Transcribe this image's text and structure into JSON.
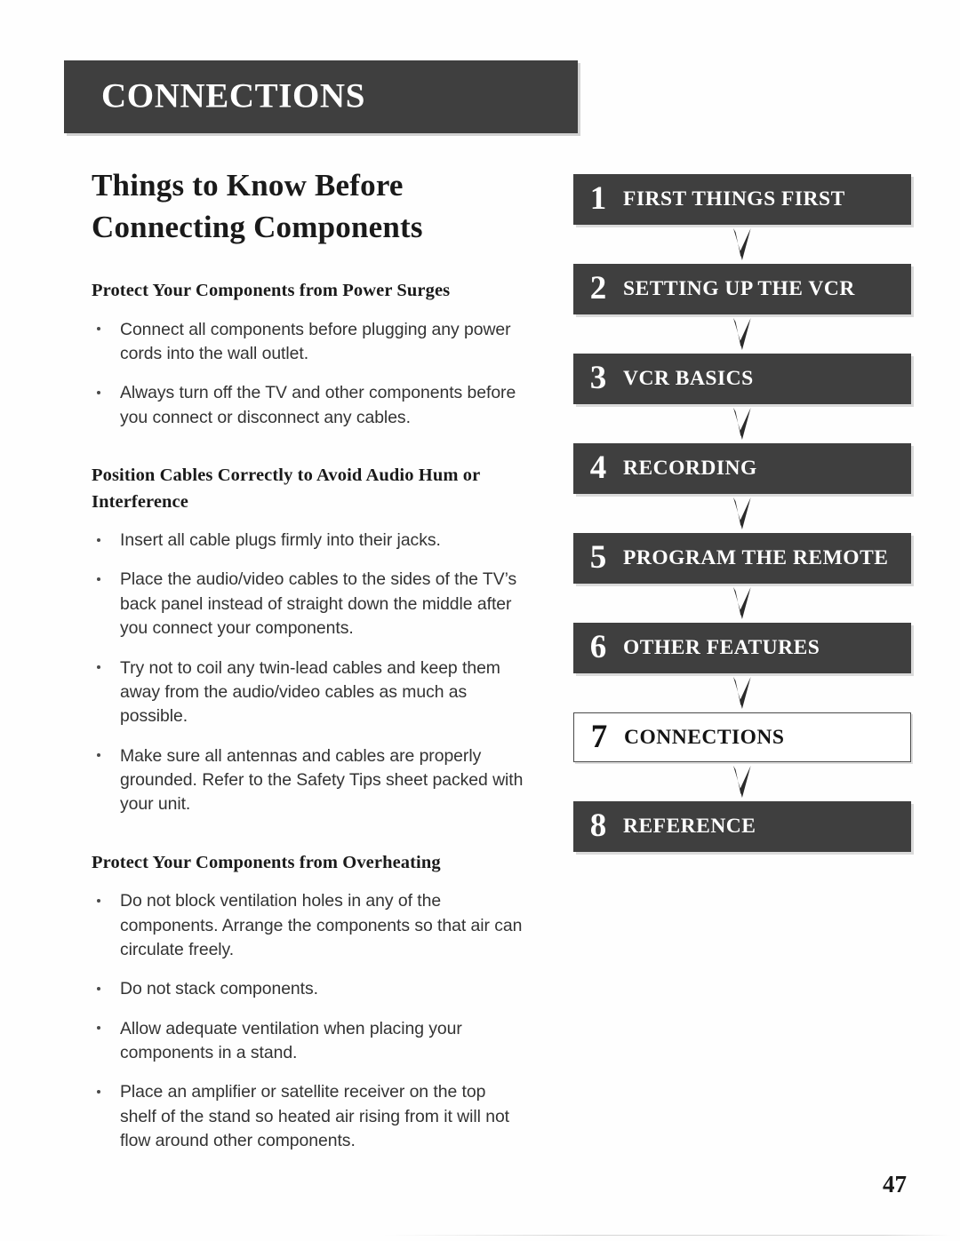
{
  "document": {
    "section_banner": "CONNECTIONS",
    "page_number": "47",
    "title": "Things to Know Before Connecting Components"
  },
  "content": {
    "subsections": [
      {
        "heading": "Protect Your Components from Power Surges",
        "bullets": [
          "Connect all components before plugging any power cords into the wall outlet.",
          "Always turn off the TV and other components before you connect or disconnect any cables."
        ]
      },
      {
        "heading": "Position Cables Correctly to Avoid Audio Hum or Interference",
        "bullets": [
          "Insert all cable plugs firmly into their jacks.",
          "Place the audio/video cables to the sides of the TV’s back panel instead of straight down the middle after you connect your components.",
          "Try not to coil any twin-lead cables and keep them away from the audio/video cables as much as possible.",
          "Make sure all antennas and cables are properly grounded. Refer to the Safety Tips sheet packed with your unit."
        ]
      },
      {
        "heading": "Protect Your Components from Overheating",
        "bullets": [
          "Do not block ventilation holes in any of the components.  Arrange the components so that air can circulate freely.",
          "Do not stack components.",
          "Allow adequate ventilation when placing your components in a stand.",
          "Place an amplifier or satellite receiver on the top shelf of the stand so heated air rising from it will not flow around other components."
        ]
      }
    ]
  },
  "nav_chain": {
    "arrow_icon": "chevron-down-arrow-icon",
    "items": [
      {
        "number": "1",
        "label": "FIRST THINGS FIRST",
        "current": false
      },
      {
        "number": "2",
        "label": "SETTING UP THE VCR",
        "current": false
      },
      {
        "number": "3",
        "label": "VCR BASICS",
        "current": false
      },
      {
        "number": "4",
        "label": "RECORDING",
        "current": false
      },
      {
        "number": "5",
        "label": "PROGRAM THE REMOTE",
        "current": false
      },
      {
        "number": "6",
        "label": "OTHER FEATURES",
        "current": false
      },
      {
        "number": "7",
        "label": "CONNECTIONS",
        "current": true
      },
      {
        "number": "8",
        "label": "REFERENCE",
        "current": false
      }
    ]
  },
  "colors": {
    "bar_background": "#3f3f3f",
    "bar_text": "#ffffff",
    "current_background": "#ffffff",
    "current_text": "#141414",
    "body_text": "#333333"
  }
}
